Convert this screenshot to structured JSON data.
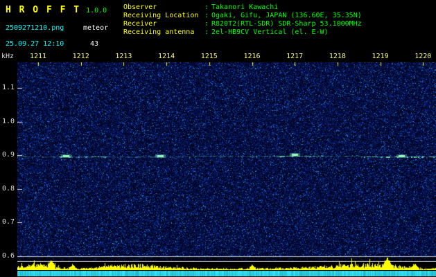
{
  "app": {
    "title": "H R O F F T",
    "version": "1.0.0",
    "filename": "2509271210.png",
    "mode": "meteor",
    "count": "43",
    "timestamp": "25.09.27 12:10"
  },
  "info": {
    "colon": ":",
    "rows": [
      {
        "label": "Observer",
        "value": "Takanori Kawachi"
      },
      {
        "label": "Receiving Location",
        "value": "Ogaki, Gifu, JAPAN (136.60E, 35.35N)"
      },
      {
        "label": "Receiver",
        "value": "R820T2(RTL-SDR) SDR-Sharp 53.1000MHz"
      },
      {
        "label": "Receiving antenna",
        "value": "2el-HB9CV Vertical (el. E-W)"
      }
    ]
  },
  "chart_data": {
    "type": "heatmap",
    "ylabel": "kHz",
    "y_ticks": [
      "1.1",
      "1.0",
      "0.9",
      "0.8",
      "0.7",
      "0.6"
    ],
    "ylim_khz": [
      0.585,
      1.175
    ],
    "x_ticks": [
      "1211",
      "1212",
      "1213",
      "1214",
      "1215",
      "1216",
      "1217",
      "1218",
      "1219",
      "1220"
    ],
    "grid": false,
    "legend": false,
    "carrier_trace": {
      "freq_khz": 0.9,
      "bright_segments_min": [
        [
          1211.4,
          1212.6
        ],
        [
          1216.5,
          1217.7
        ],
        [
          1218.5,
          1220.3
        ]
      ],
      "echo_times_min": [
        1211.65,
        1213.85,
        1217.0,
        1219.5
      ]
    },
    "separator_lines_khz": [
      0.6,
      0.586
    ],
    "level_spikes": [
      [
        1211.3,
        8
      ],
      [
        1211.8,
        6
      ],
      [
        1216.0,
        5
      ],
      [
        1219.15,
        14
      ],
      [
        1219.8,
        7
      ]
    ],
    "colors": {
      "background": "#000000",
      "noise_blue": "#0000aa",
      "trace_green": "#96ffbe",
      "bar_yellow": "#ffff00",
      "band_cyan": "#37d2e6",
      "label_yellow": "#ffff00",
      "value_green": "#00ff00",
      "cyan_text": "#00ffff",
      "white_text": "#ffffff",
      "tick_white": "#dddddd",
      "xtick_yellow": "#ffff88"
    }
  }
}
